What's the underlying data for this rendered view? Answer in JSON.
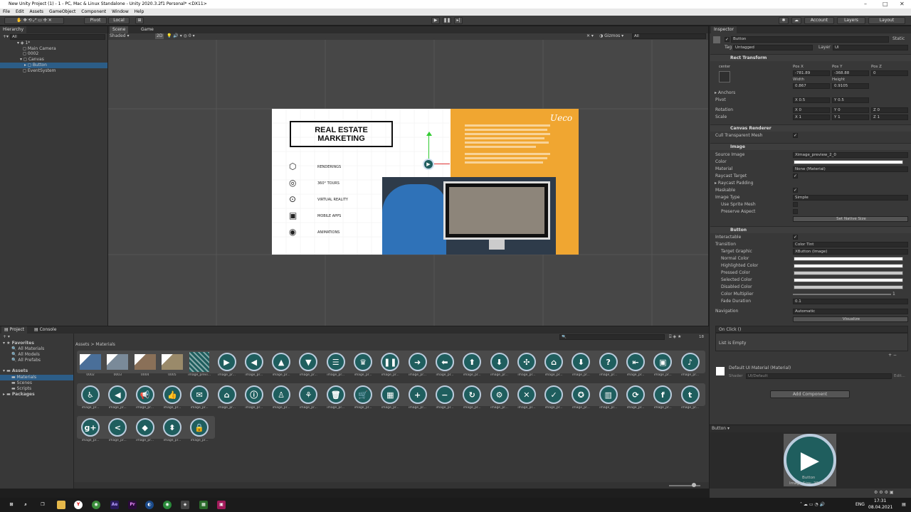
{
  "window": {
    "title": "New Unity Project (1) - 1 - PC, Mac & Linux Standalone - Unity 2020.3.2f1 Personal* <DX11>"
  },
  "menu": [
    "File",
    "Edit",
    "Assets",
    "GameObject",
    "Component",
    "Window",
    "Help"
  ],
  "toolbar": {
    "pivot": "Pivot",
    "local": "Local",
    "account": "Account",
    "layers": "Layers",
    "layout": "Layout"
  },
  "hierarchy": {
    "tab": "Hierarchy",
    "search_placeholder": "All",
    "items": [
      {
        "label": "1*"
      },
      {
        "label": "Main Camera"
      },
      {
        "label": "0002"
      },
      {
        "label": "Canvas"
      },
      {
        "label": "Button"
      },
      {
        "label": "EventSystem"
      }
    ]
  },
  "scene": {
    "tabs": [
      "Scene",
      "Game"
    ],
    "shading": "Shaded",
    "mode_2d": "2D",
    "gizmos": "Gizmos",
    "search_placeholder": "All",
    "gizmo_count": "0"
  },
  "slide": {
    "title_line1": "REAL ESTATE",
    "title_line2": "MARKETING",
    "services": [
      "RENDERINGS",
      "360° TOURS",
      "VIRTUAL REALITY",
      "MOBILE APPS",
      "ANIMATIONS"
    ],
    "logo": "Ueco",
    "orange_color": "#f0a631"
  },
  "inspector": {
    "tab": "Inspector",
    "object_name": "Button",
    "static": "Static",
    "tag_label": "Tag",
    "tag_value": "Untagged",
    "layer_label": "Layer",
    "layer_value": "UI",
    "rect_transform": "Rect Transform",
    "anchor_h": "center",
    "anchor_v": "middle",
    "posx_label": "Pos X",
    "posy_label": "Pos Y",
    "posz_label": "Pos Z",
    "posx": "-781.89",
    "posy": "-368.88",
    "posz": "0",
    "width_label": "Width",
    "height_label": "Height",
    "width": "0.867",
    "height": "0.9105",
    "anchors": "Anchors",
    "pivot_label": "Pivot",
    "pivot_x": "X 0.5",
    "pivot_y": "Y 0.5",
    "rotation_label": "Rotation",
    "rot_x": "X 0",
    "rot_y": "Y 0",
    "rot_z": "Z 0",
    "scale_label": "Scale",
    "scale_x": "X 1",
    "scale_y": "Y 1",
    "scale_z": "Z 1",
    "canvas_renderer": "Canvas Renderer",
    "cull": "Cull Transparent Mesh",
    "image": "Image",
    "source_image_label": "Source Image",
    "source_image": "Ximage_preview_2_0",
    "color_label": "Color",
    "material_label": "Material",
    "material": "None (Material)",
    "raycast_target": "Raycast Target",
    "raycast_padding": "Raycast Padding",
    "maskable": "Maskable",
    "image_type_label": "Image Type",
    "image_type": "Simple",
    "use_sprite_mesh": "Use Sprite Mesh",
    "preserve_aspect": "Preserve Aspect",
    "set_native": "Set Native Size",
    "button": "Button",
    "interactable": "Interactable",
    "transition_label": "Transition",
    "transition": "Color Tint",
    "target_graphic_label": "Target Graphic",
    "target_graphic": "XButton (Image)",
    "normal": "Normal Color",
    "highlighted": "Highlighted Color",
    "pressed": "Pressed Color",
    "selected": "Selected Color",
    "disabled": "Disabled Color",
    "multiplier_label": "Color Multiplier",
    "multiplier": "1",
    "fade_label": "Fade Duration",
    "fade": "0.1",
    "navigation_label": "Navigation",
    "navigation": "Automatic",
    "visualize": "Visualize",
    "onclick": "On Click ()",
    "list_empty": "List is Empty",
    "material_name": "Default UI Material (Material)",
    "shader_label": "Shader",
    "shader": "UI/Default",
    "edit": "Edit...",
    "add_component": "Add Component",
    "preview_header": "Button",
    "preview_caption1": "Button",
    "preview_caption2": "Image Size: 28x0"
  },
  "project": {
    "tabs": [
      "Project",
      "Console"
    ],
    "favorites": "Favorites",
    "fav_items": [
      "All Materials",
      "All Models",
      "All Prefabs"
    ],
    "assets": "Assets",
    "asset_folders": [
      "Materials",
      "Scenes",
      "Scripts"
    ],
    "packages": "Packages",
    "breadcrumb_root": "Assets",
    "breadcrumb_sep": ">",
    "breadcrumb_leaf": "Materials",
    "count": "18",
    "items": [
      {
        "label": "0002",
        "kind": "photo"
      },
      {
        "label": "0003",
        "kind": "photo"
      },
      {
        "label": "0004",
        "kind": "photo"
      },
      {
        "label": "0005",
        "kind": "photo"
      },
      {
        "label": "image_previ...",
        "kind": "pattern"
      },
      {
        "label": "image_pr...",
        "icon": "▶"
      },
      {
        "label": "image_pr...",
        "icon": "◀"
      },
      {
        "label": "image_pr...",
        "icon": "▲"
      },
      {
        "label": "image_pr...",
        "icon": "▼"
      },
      {
        "label": "image_pr...",
        "icon": "☰"
      },
      {
        "label": "image_pr...",
        "icon": "♛"
      },
      {
        "label": "image_pr...",
        "icon": "❚❚"
      },
      {
        "label": "image_pr...",
        "icon": "➜"
      },
      {
        "label": "image_pr...",
        "icon": "⬅"
      },
      {
        "label": "image_pr...",
        "icon": "⬆"
      },
      {
        "label": "image_pr...",
        "icon": "⬇"
      },
      {
        "label": "image_pr...",
        "icon": "✣"
      },
      {
        "label": "image_pr...",
        "icon": "⌂"
      },
      {
        "label": "image_pr...",
        "icon": "⬇"
      },
      {
        "label": "image_pr...",
        "icon": "?"
      },
      {
        "label": "image_pr...",
        "icon": "⇤"
      },
      {
        "label": "image_pr...",
        "icon": "▣"
      },
      {
        "label": "image_pr...",
        "icon": "♪"
      },
      {
        "label": "image_pr...",
        "icon": "♿"
      },
      {
        "label": "image_pr...",
        "icon": "◀"
      },
      {
        "label": "image_pr...",
        "icon": "📢"
      },
      {
        "label": "image_pr...",
        "icon": "👍"
      },
      {
        "label": "image_pr...",
        "icon": "✉"
      },
      {
        "label": "image_pr...",
        "icon": "⌂"
      },
      {
        "label": "image_pr...",
        "icon": "ⓘ"
      },
      {
        "label": "image_pr...",
        "icon": "♙"
      },
      {
        "label": "image_pr...",
        "icon": "⚘"
      },
      {
        "label": "image_pr...",
        "icon": "🗑"
      },
      {
        "label": "image_pr...",
        "icon": "🛒"
      },
      {
        "label": "image_pr...",
        "icon": "▦"
      },
      {
        "label": "image_pr...",
        "icon": "+"
      },
      {
        "label": "image_pr...",
        "icon": "−"
      },
      {
        "label": "image_pr...",
        "icon": "↻"
      },
      {
        "label": "image_pr...",
        "icon": "⚙"
      },
      {
        "label": "image_pr...",
        "icon": "✕"
      },
      {
        "label": "image_pr...",
        "icon": "✓"
      },
      {
        "label": "image_pr...",
        "icon": "✪"
      },
      {
        "label": "image_pr...",
        "icon": "▥"
      },
      {
        "label": "image_pr...",
        "icon": "⟳"
      },
      {
        "label": "image_pr...",
        "icon": "f"
      },
      {
        "label": "image_pr...",
        "icon": "t"
      },
      {
        "label": "image_pr...",
        "icon": "g+"
      },
      {
        "label": "image_pr...",
        "icon": "<"
      },
      {
        "label": "image_pr...",
        "icon": "◆"
      },
      {
        "label": "image_pr...",
        "icon": "⬍"
      },
      {
        "label": "image_pr...",
        "icon": "🔒"
      }
    ]
  },
  "taskbar": {
    "lang": "ENG",
    "time": "17:31",
    "date": "08.04.2021"
  }
}
